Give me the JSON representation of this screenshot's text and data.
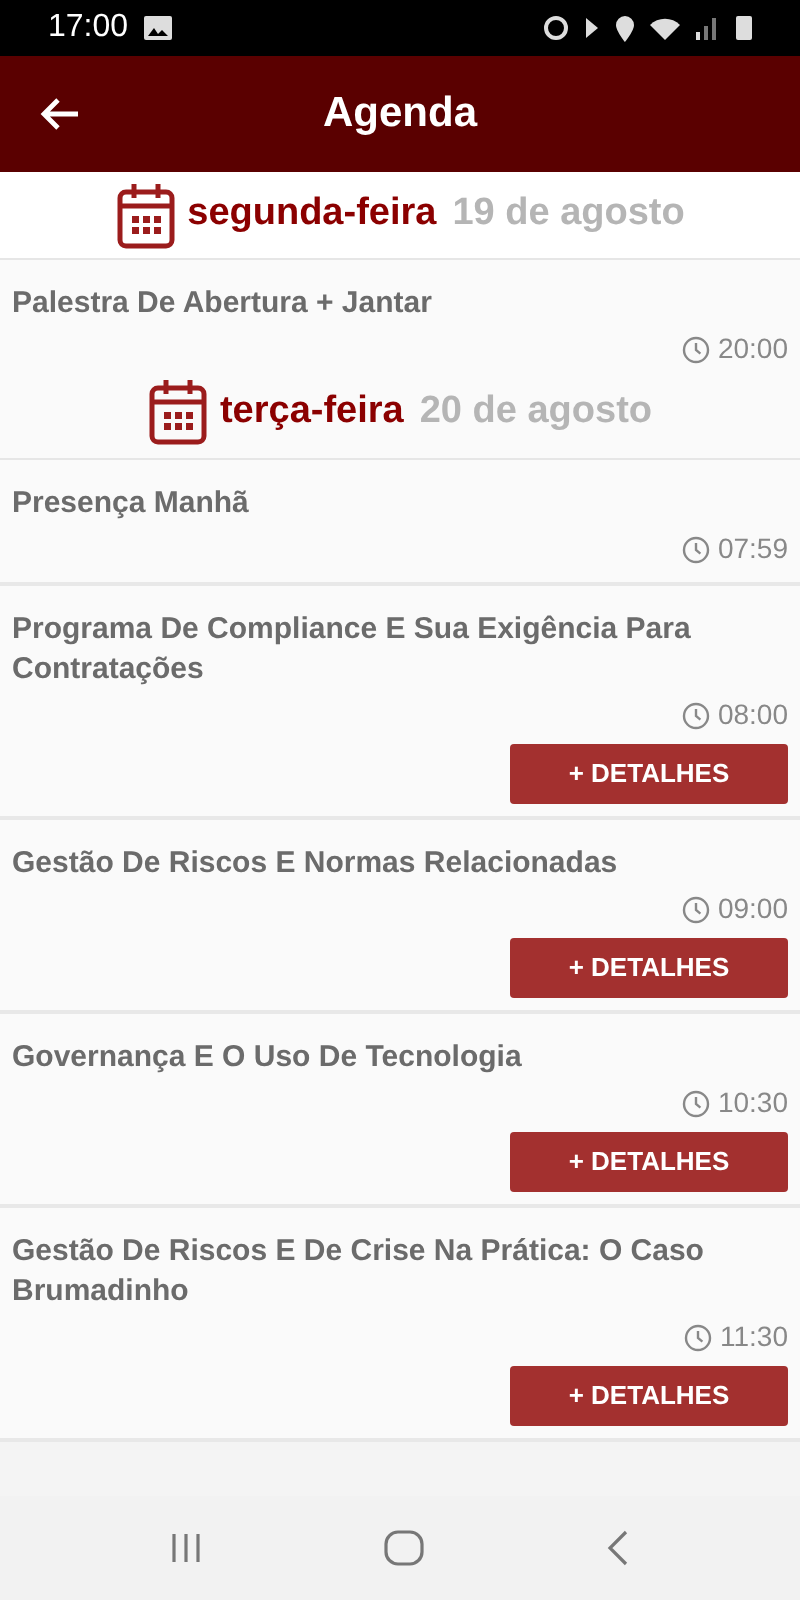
{
  "status_bar": {
    "time": "17:00"
  },
  "header": {
    "title": "Agenda"
  },
  "days": [
    {
      "weekday": "segunda-feira",
      "date": "19 de agosto",
      "events": [
        {
          "title": "Palestra De Abertura + Jantar",
          "time": "20:00"
        }
      ]
    },
    {
      "weekday": "terça-feira",
      "date": "20 de agosto",
      "events": [
        {
          "title": "Presença Manhã",
          "time": "07:59"
        },
        {
          "title": "Programa De Compliance E Sua Exigência Para Contratações",
          "time": "08:00",
          "button": "+ DETALHES"
        },
        {
          "title": "Gestão De Riscos E Normas Relacionadas",
          "time": "09:00",
          "button": "+ DETALHES"
        },
        {
          "title": "Governança E O Uso De Tecnologia",
          "time": "10:30",
          "button": "+ DETALHES"
        },
        {
          "title": "Gestão De Riscos E De Crise Na Prática: O Caso Brumadinho",
          "time": "11:30",
          "button": "+ DETALHES"
        }
      ]
    }
  ]
}
